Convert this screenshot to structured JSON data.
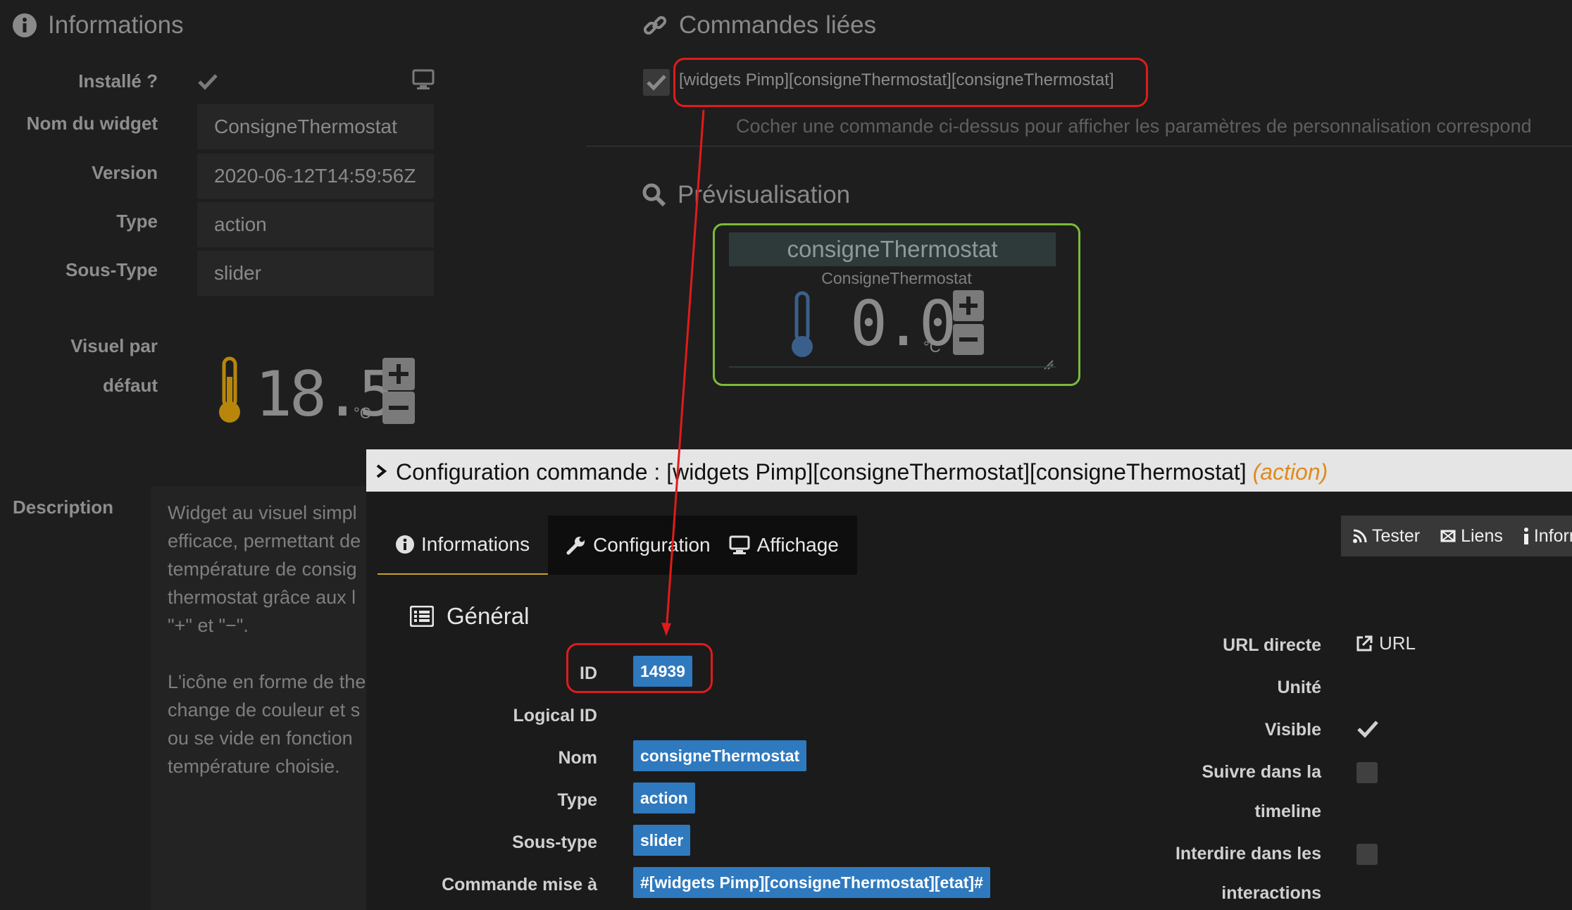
{
  "informations": {
    "title": "Informations",
    "installed_label": "Installé ?",
    "fields": [
      {
        "label": "Nom du widget",
        "value": "ConsigneThermostat"
      },
      {
        "label": "Version",
        "value": "2020-06-12T14:59:56Z"
      },
      {
        "label": "Type",
        "value": "action"
      },
      {
        "label": "Sous-Type",
        "value": "slider"
      }
    ],
    "visuel_label_1": "Visuel par",
    "visuel_label_2": "défaut",
    "visuel_value": "18.5",
    "visuel_unit": "°C",
    "description_label": "Description",
    "description_lines": [
      "Widget au visuel simpl",
      "efficace, permettant de",
      "température de consig",
      "thermostat grâce aux l",
      "\"+\" et \"−\"."
    ],
    "description_lines_2": [
      "L'icône en forme de the",
      "change de couleur et s",
      "ou se vide en fonction",
      "température choisie."
    ]
  },
  "commandes": {
    "title": "Commandes liées",
    "linked": "[widgets Pimp][consigneThermostat][consigneThermostat]",
    "hint": "Cocher une commande ci-dessus pour afficher les paramètres de personnalisation correspond"
  },
  "preview": {
    "title": "Prévisualisation",
    "widget_title": "consigneThermostat",
    "widget_sub": "ConsigneThermostat",
    "value": "0.0",
    "unit": "°C"
  },
  "modal": {
    "title_prefix": "Configuration commande : [widgets Pimp][consigneThermostat][consigneThermostat] ",
    "title_type": "(action)",
    "tabs": [
      {
        "label": "Informations",
        "icon": "info-icon"
      },
      {
        "label": "Configuration",
        "icon": "wrench-icon"
      },
      {
        "label": "Affichage",
        "icon": "monitor-icon"
      }
    ],
    "buttons": [
      {
        "label": "Tester",
        "icon": "rss-icon"
      },
      {
        "label": "Liens",
        "icon": "link-icon"
      },
      {
        "label": "Inforr",
        "icon": "info-icon"
      }
    ],
    "general_title": "Général",
    "left_fields": [
      {
        "label": "ID",
        "value": "14939"
      },
      {
        "label": "Logical ID",
        "value": ""
      },
      {
        "label": "Nom",
        "value": "consigneThermostat"
      },
      {
        "label": "Type",
        "value": "action"
      },
      {
        "label": "Sous-type",
        "value": "slider"
      },
      {
        "label": "Commande mise à",
        "value": "#[widgets Pimp][consigneThermostat][etat]#"
      }
    ],
    "right": {
      "url_label": "URL directe",
      "url_link": "URL",
      "unite_label": "Unité",
      "visible_label": "Visible",
      "suivre_label_1": "Suivre dans la",
      "suivre_label_2": "timeline",
      "interdire_label_1": "Interdire dans les",
      "interdire_label_2": "interactions"
    }
  },
  "colors": {
    "accent_blue": "#2f79be",
    "annotation_red": "#e01b1b",
    "preview_green": "#7cba3b",
    "action_orange": "#e08a1c"
  }
}
